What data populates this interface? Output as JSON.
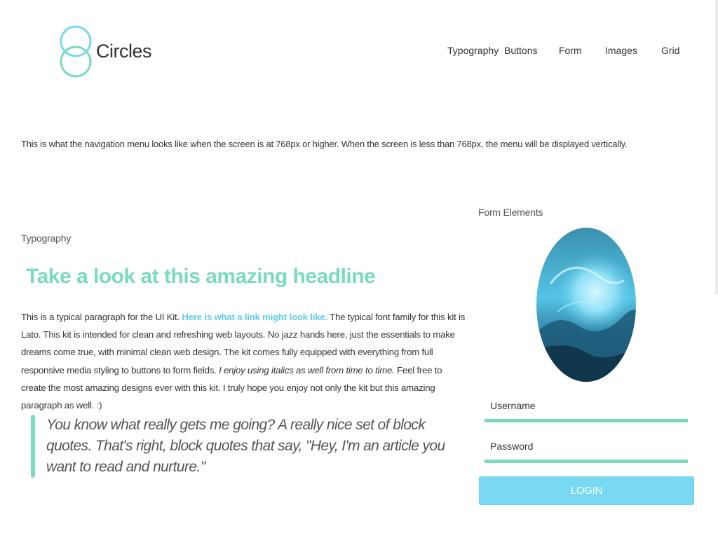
{
  "brand": {
    "name": "Circles",
    "accent": "#7adbbe",
    "link_color": "#5ccde8",
    "button_color": "#79d9f3",
    "logo_icon": "circles-logo-icon"
  },
  "nav": {
    "items": [
      "Typography",
      "Buttons",
      "Form",
      "Images",
      "Grid"
    ]
  },
  "intro": "This is what the navigation menu looks like when the screen is at 768px or higher. When the screen is less than 768px, the menu will be displayed vertically.",
  "typography": {
    "label": "Typography",
    "headline": "Take a look at this amazing headline",
    "para_start": "This is a typical paragraph for the UI Kit. ",
    "link_text": "Here is what a link might look like.",
    "para_mid": " The typical font family for this kit is Lato. This kit is intended for clean and refreshing web layouts. No jazz hands here, just the essentials to make dreams come true, with minimal clean web design. The kit comes fully equipped with everything from full responsive media styling to buttons to form fields. ",
    "italic_text": "I enjoy using italics as well from time to time.",
    "para_end": " Feel free to create the most amazing designs ever with this kit. I truly hope you enjoy not only the kit but this amazing paragraph as well. :)"
  },
  "quote": "You know what really gets me going? A really nice set of block quotes. That's right, block quotes that say, \"Hey, I'm an article you want to read and nurture.\"",
  "form": {
    "label": "Form Elements",
    "username_placeholder": "Username",
    "password_placeholder": "Password",
    "login_label": "LOGIN"
  }
}
